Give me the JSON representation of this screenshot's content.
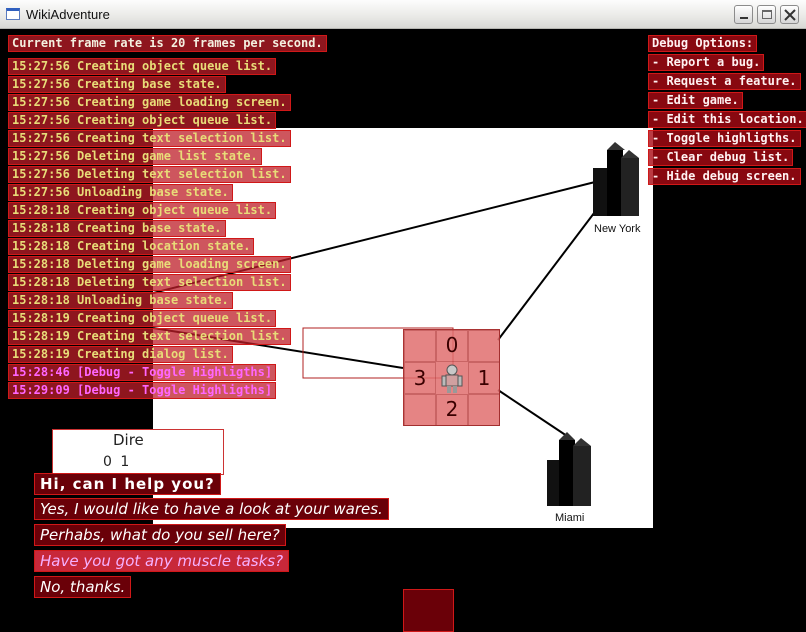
{
  "window": {
    "title": "WikiAdventure"
  },
  "framerate": "Current frame rate is 20 frames per second.",
  "log": [
    {
      "time": "15:27:56",
      "text": "Creating object queue list.",
      "color": "yellow"
    },
    {
      "time": "15:27:56",
      "text": "Creating base state.",
      "color": "yellow"
    },
    {
      "time": "15:27:56",
      "text": "Creating game loading screen.",
      "color": "yellow"
    },
    {
      "time": "15:27:56",
      "text": "Creating object queue list.",
      "color": "yellow"
    },
    {
      "time": "15:27:56",
      "text": "Creating text selection list.",
      "color": "yellow"
    },
    {
      "time": "15:27:56",
      "text": "Deleting game list state.",
      "color": "yellow"
    },
    {
      "time": "15:27:56",
      "text": "Deleting text selection list.",
      "color": "yellow"
    },
    {
      "time": "15:27:56",
      "text": "Unloading base state.",
      "color": "yellow"
    },
    {
      "time": "15:28:18",
      "text": "Creating object queue list.",
      "color": "yellow"
    },
    {
      "time": "15:28:18",
      "text": "Creating base state.",
      "color": "yellow"
    },
    {
      "time": "15:28:18",
      "text": "Creating location state.",
      "color": "yellow"
    },
    {
      "time": "15:28:18",
      "text": "Deleting game loading screen.",
      "color": "yellow"
    },
    {
      "time": "15:28:18",
      "text": "Deleting text selection list.",
      "color": "yellow"
    },
    {
      "time": "15:28:18",
      "text": "Unloading base state.",
      "color": "yellow"
    },
    {
      "time": "15:28:19",
      "text": "Creating object queue list.",
      "color": "yellow"
    },
    {
      "time": "15:28:19",
      "text": "Creating text selection list.",
      "color": "yellow"
    },
    {
      "time": "15:28:19",
      "text": "Creating dialog list.",
      "color": "yellow"
    },
    {
      "time": "15:28:46",
      "text": "[Debug - Toggle Highligths]",
      "color": "pink"
    },
    {
      "time": "15:29:09",
      "text": "[Debug - Toggle Highligths]",
      "color": "pink"
    }
  ],
  "debug": {
    "header": "Debug Options:",
    "items": [
      "- Report a bug.",
      "- Request a feature.",
      "- Edit game.",
      "- Edit this location.",
      "- Toggle highligths.",
      "- Clear debug list.",
      "- Hide debug screen."
    ]
  },
  "map": {
    "cities": [
      "New York",
      "Miami"
    ],
    "directions": {
      "north": "0",
      "east": "1",
      "south": "2",
      "west": "3"
    }
  },
  "dialog_panel": {
    "title": "Dire",
    "nums": "0 1"
  },
  "dialog": {
    "npc_line": "Hi, can I help you?",
    "options": [
      "Yes, I would like to have a look at your wares.",
      "Perhabs, what do you sell here?",
      "Have you got any muscle tasks?",
      "No, thanks."
    ],
    "selected_index": 2
  },
  "colors": {
    "accent": "#d01818",
    "log_text": "#e8dc78",
    "highlight": "#ff66ff"
  }
}
